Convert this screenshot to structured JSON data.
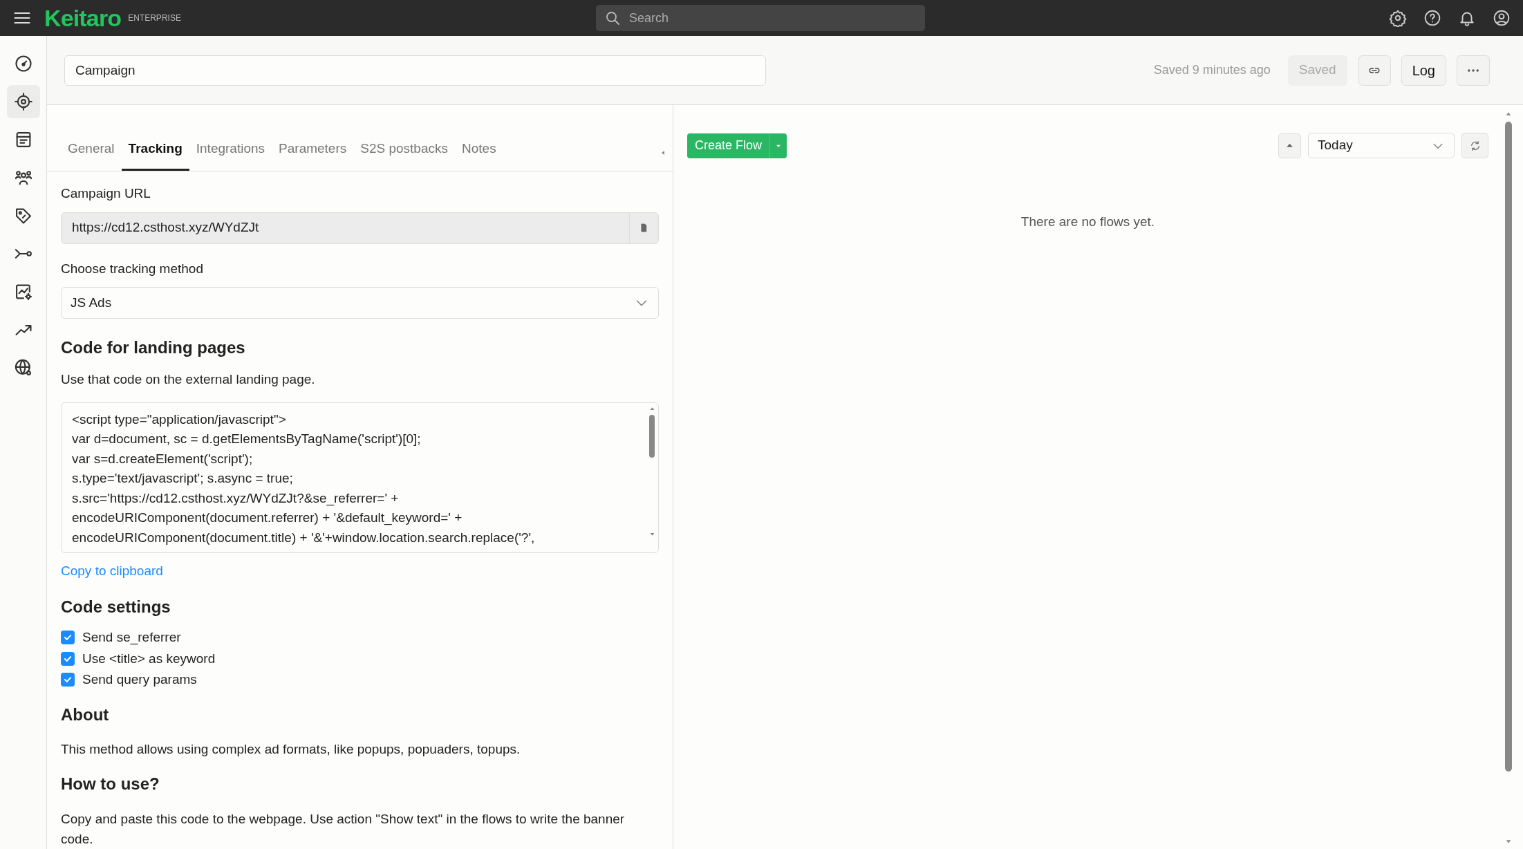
{
  "topbar": {
    "logo": "Keitaro",
    "edition": "ENTERPRISE",
    "search": {
      "placeholder": "Search"
    }
  },
  "sidebar": {
    "items": [
      {
        "selected": false
      },
      {
        "selected": true
      },
      {
        "selected": false
      },
      {
        "selected": false
      },
      {
        "selected": false
      },
      {
        "selected": false
      },
      {
        "selected": false
      },
      {
        "selected": false
      },
      {
        "selected": false
      }
    ]
  },
  "header": {
    "name": "Campaign",
    "saved_time": "Saved 9 minutes ago",
    "save_button": {
      "label": "Saved",
      "disabled": true
    },
    "log_button": "Log"
  },
  "tabs": [
    {
      "label": "General",
      "selected": false
    },
    {
      "label": "Tracking",
      "selected": true
    },
    {
      "label": "Integrations",
      "selected": false
    },
    {
      "label": "Parameters",
      "selected": false
    },
    {
      "label": "S2S postbacks",
      "selected": false
    },
    {
      "label": "Notes",
      "selected": false
    }
  ],
  "tracking": {
    "url_label": "Campaign URL",
    "url": "https://cd12.csthost.xyz/WYdZJt",
    "method_label": "Choose tracking method",
    "method": "JS Ads",
    "code_heading": "Code for landing pages",
    "code_hint": "Use that code on the external landing page.",
    "code": "<script type=\"application/javascript\">\nvar d=document, sc = d.getElementsByTagName('script')[0];\nvar s=d.createElement('script');\ns.type='text/javascript'; s.async = true;\ns.src='https://cd12.csthost.xyz/WYdZJt?&se_referrer=' +\nencodeURIComponent(document.referrer) + '&default_keyword=' +\nencodeURIComponent(document.title) + '&'+window.location.search.replace('?',",
    "copy_link": "Copy to clipboard",
    "settings_heading": "Code settings",
    "settings": [
      {
        "label": "Send se_referrer",
        "checked": true
      },
      {
        "label": "Use <title> as keyword",
        "checked": true
      },
      {
        "label": "Send query params",
        "checked": true
      }
    ],
    "about_heading": "About",
    "about_text": "This method allows using complex ad formats, like popups, popuaders, topups.",
    "howto_heading": "How to use?",
    "howto_text": "Copy and paste this code to the webpage. Use action \"Show text\" in the flows to write the banner code."
  },
  "flows": {
    "create_button": "Create Flow",
    "period": "Today",
    "empty": "There are no flows yet."
  }
}
